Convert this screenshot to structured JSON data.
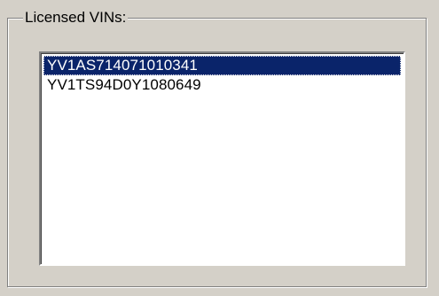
{
  "groupbox": {
    "label": "Licensed VINs:"
  },
  "listbox": {
    "items": [
      {
        "label": "YV1AS714071010341",
        "selected": true
      },
      {
        "label": "YV1TS94D0Y1080649",
        "selected": false
      }
    ]
  },
  "colors": {
    "background": "#d4d0c8",
    "selection": "#0a246a",
    "selection_text": "#ffffff",
    "list_background": "#ffffff"
  }
}
